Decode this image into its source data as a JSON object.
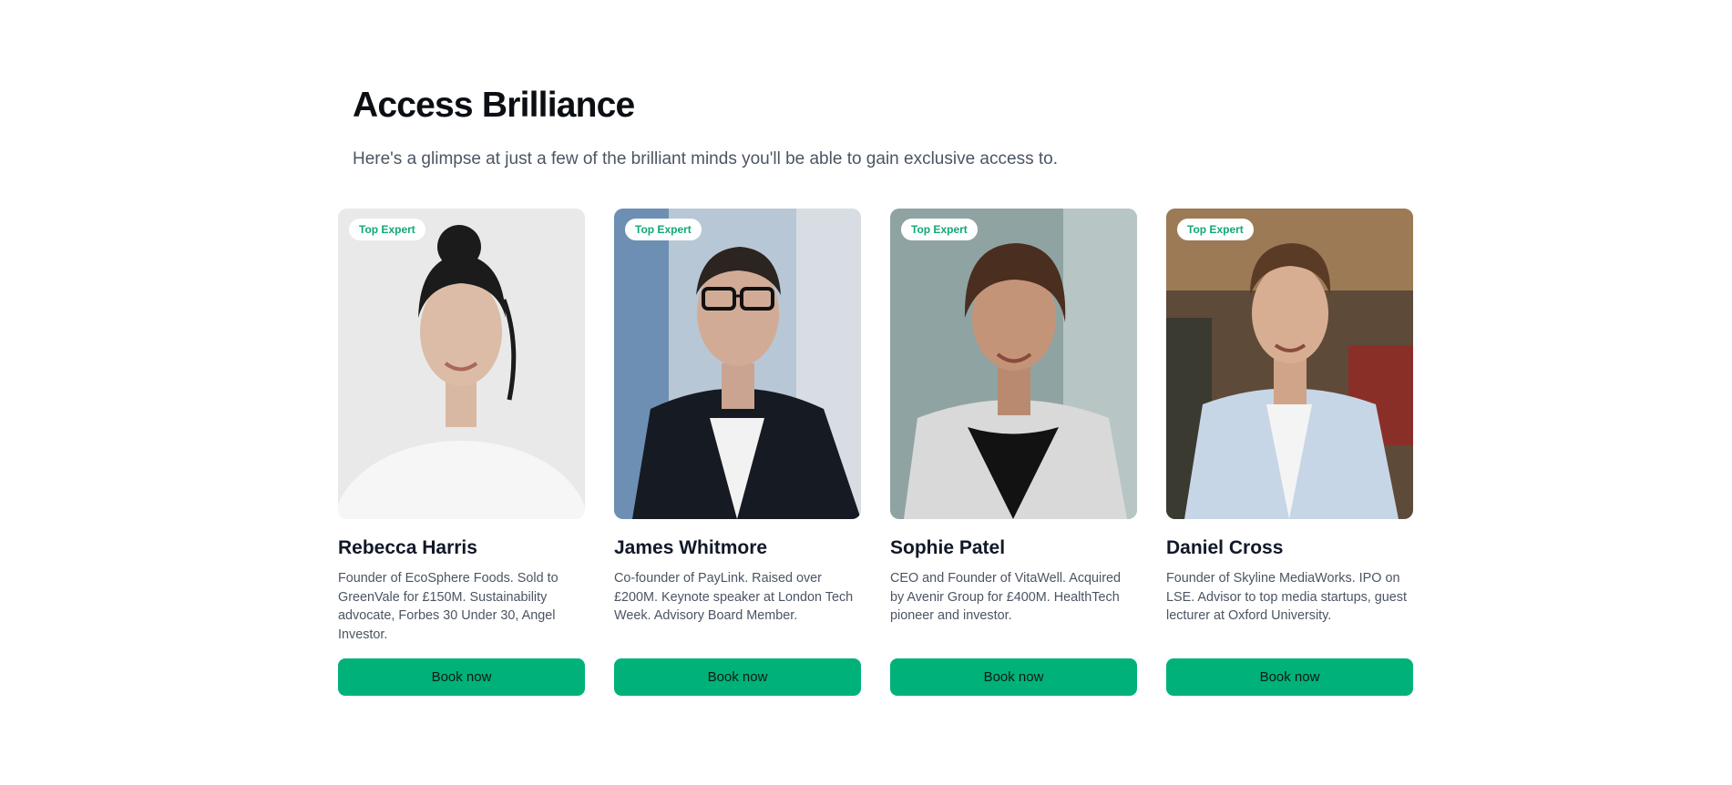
{
  "header": {
    "title": "Access Brilliance",
    "subtitle": "Here's a glimpse at just a few of the brilliant minds you'll be able to gain exclusive access to."
  },
  "experts": [
    {
      "badge": "Top Expert",
      "name": "Rebecca Harris",
      "bio": "Founder of EcoSphere Foods. Sold to GreenVale for £150M. Sustainability advocate, Forbes 30 Under 30, Angel Investor.",
      "button": "Book now"
    },
    {
      "badge": "Top Expert",
      "name": "James Whitmore",
      "bio": "Co-founder of PayLink. Raised over £200M. Keynote speaker at London Tech Week. Advisory Board Member.",
      "button": "Book now"
    },
    {
      "badge": "Top Expert",
      "name": "Sophie Patel",
      "bio": "CEO and Founder of VitaWell. Acquired by Avenir Group for £400M. HealthTech pioneer and investor.",
      "button": "Book now"
    },
    {
      "badge": "Top Expert",
      "name": "Daniel Cross",
      "bio": "Founder of Skyline MediaWorks. IPO on LSE. Advisor to top media startups, guest lecturer at Oxford University.",
      "button": "Book now"
    }
  ],
  "colors": {
    "accent": "#00b27a",
    "badge_text": "#10a874"
  }
}
